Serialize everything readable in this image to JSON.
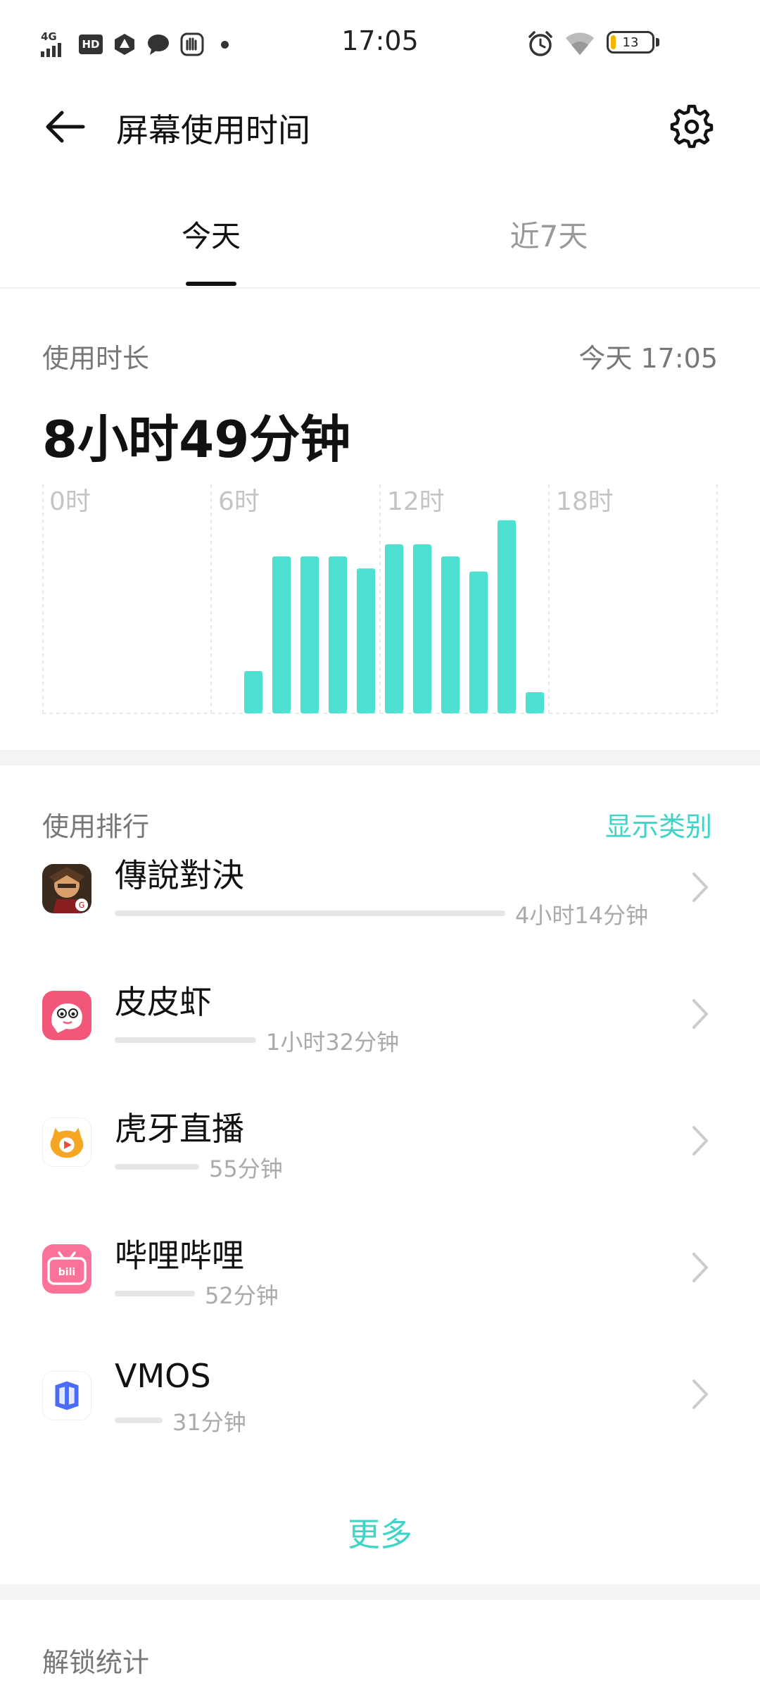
{
  "status_bar": {
    "network": "4G",
    "hd": "HD",
    "time": "17:05",
    "battery": "13",
    "battery_color": "#f2b705",
    "icons": [
      "signal-icon",
      "hd-icon",
      "notification-icon",
      "message-icon",
      "app-notification-icon",
      "dot-icon",
      "alarm-icon",
      "wifi-icon",
      "battery-icon"
    ]
  },
  "header": {
    "title": "屏幕使用时间",
    "back_icon": "back-arrow-icon",
    "settings_icon": "gear-icon"
  },
  "tabs": [
    {
      "label": "今天",
      "selected": true
    },
    {
      "label": "近7天",
      "selected": false
    }
  ],
  "usage": {
    "label": "使用时长",
    "timestamp": "今天 17:05",
    "total": "8小时49分钟"
  },
  "chart_data": {
    "type": "bar",
    "x_tick_labels": [
      "0时",
      "6时",
      "12时",
      "18时"
    ],
    "hours": [
      7,
      8,
      9,
      10,
      11,
      12,
      13,
      14,
      15,
      16,
      17
    ],
    "values_minutes": [
      14,
      52,
      52,
      52,
      48,
      56,
      56,
      52,
      47,
      64,
      7
    ],
    "xlim": [
      0,
      24
    ],
    "ylabel": "",
    "bar_color": "#4fe0d4",
    "grid": true
  },
  "ranking": {
    "label": "使用排行",
    "category_link": "显示类别",
    "accent_color": "#3fd4c6",
    "apps": [
      {
        "name": "傳說對決",
        "time": "4小时14分钟",
        "minutes": 254,
        "icon": "aov-app-icon"
      },
      {
        "name": "皮皮虾",
        "time": "1小时32分钟",
        "minutes": 92,
        "icon": "pipixia-app-icon"
      },
      {
        "name": "虎牙直播",
        "time": "55分钟",
        "minutes": 55,
        "icon": "huya-app-icon"
      },
      {
        "name": "哔哩哔哩",
        "time": "52分钟",
        "minutes": 52,
        "icon": "bilibili-app-icon"
      },
      {
        "name": "VMOS",
        "time": "31分钟",
        "minutes": 31,
        "icon": "vmos-app-icon"
      }
    ],
    "more": "更多"
  },
  "unlock": {
    "label": "解锁统计"
  }
}
